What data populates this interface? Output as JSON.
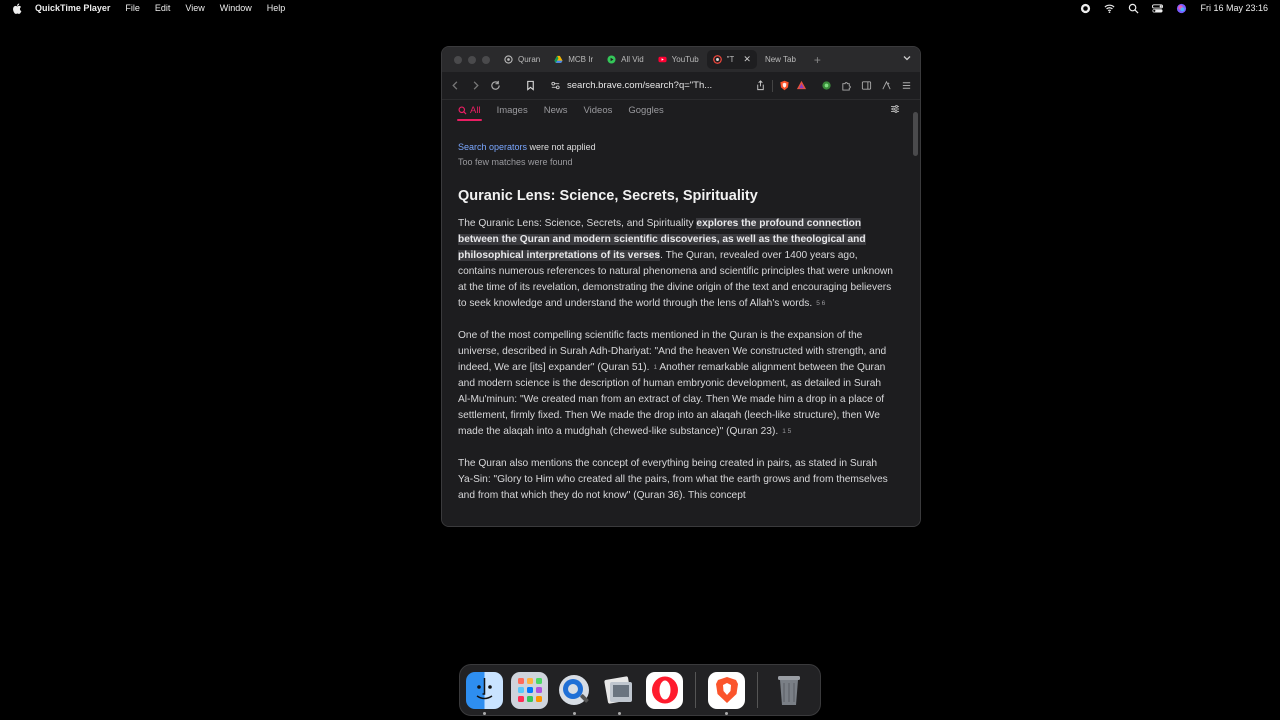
{
  "menubar": {
    "app_name": "QuickTime Player",
    "menus": [
      "File",
      "Edit",
      "View",
      "Window",
      "Help"
    ],
    "clock": "Fri 16 May  23:16"
  },
  "browser": {
    "tabs": [
      {
        "label": "Quran",
        "color": "#888888"
      },
      {
        "label": "MCB Ir",
        "color": "#f4b400"
      },
      {
        "label": "All Vid",
        "color": "#34c759"
      },
      {
        "label": "YouTub",
        "color": "#ff0033"
      },
      {
        "label": "\"T",
        "color": "#e8443a",
        "active": true
      },
      {
        "label": "New Tab",
        "color": ""
      }
    ],
    "url": "search.brave.com/search?q=\"Th...",
    "shield_badge": "1"
  },
  "search": {
    "tabs": [
      "All",
      "Images",
      "News",
      "Videos",
      "Goggles"
    ],
    "operators_link": "Search operators",
    "operators_rest": " were not applied",
    "few_matches": "Too few matches were found"
  },
  "answer": {
    "title": "Quranic Lens: Science, Secrets, Spirituality",
    "p1_a": "The Quranic Lens: Science, Secrets, and Spirituality ",
    "p1_hl": "explores the profound connection between the Quran and modern scientific discoveries, as well as the theological and philosophical interpretations of its verses",
    "p1_b": ". The Quran, revealed over 1400 years ago, contains numerous references to natural phenomena and scientific principles that were unknown at the time of its revelation, demonstrating the divine origin of the text and encouraging believers to seek knowledge and understand the world through the lens of Allah's words.",
    "p1_cites": "5  6",
    "p2_a": "One of the most compelling scientific facts mentioned in the Quran is the expansion of the universe, described in Surah Adh-Dhariyat: \"And the heaven We constructed with strength, and indeed, We are [its] expander\" (Quran 51).",
    "p2_cite1": "1",
    "p2_b": " Another remarkable alignment between the Quran and modern science is the description of human embryonic development, as detailed in Surah Al-Mu'minun: \"We created man from an extract of clay. Then We made him a drop in a place of settlement, firmly fixed. Then We made the drop into an alaqah (leech-like structure), then We made the alaqah into a mudghah (chewed-like substance)\" (Quran 23).",
    "p2_cites": "1  5",
    "p3": "The Quran also mentions the concept of everything being created in pairs, as stated in Surah Ya-Sin: \"Glory to Him who created all the pairs, from what the earth grows and from themselves and from that which they do not know\" (Quran 36). This concept"
  },
  "dock": [
    "finder",
    "launchpad",
    "quicktime",
    "preview",
    "opera",
    "brave",
    "trash"
  ],
  "colors": {
    "accent": "#e91e63",
    "link": "#7aa7ff",
    "brave": "#fb542b",
    "opera": "#ff1b2d"
  }
}
